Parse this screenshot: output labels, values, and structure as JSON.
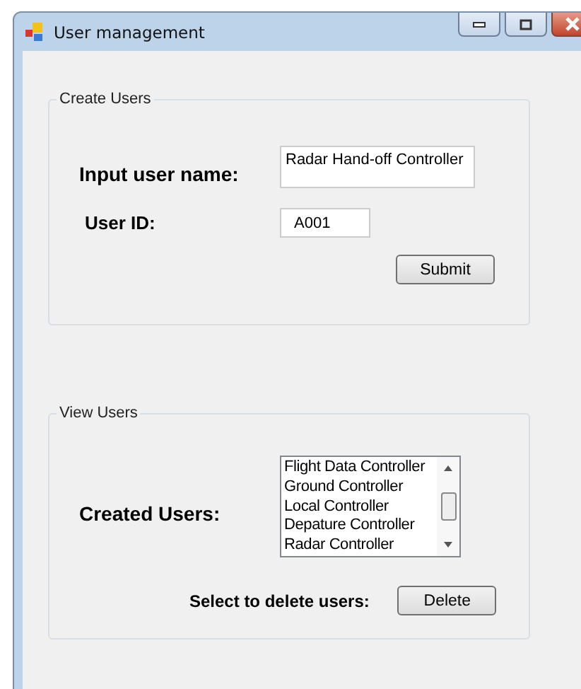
{
  "window": {
    "title": "User management"
  },
  "create_users": {
    "title": "Create Users",
    "name_label": "Input user name:",
    "name_value": "Radar Hand-off Controller",
    "id_label": "User ID:",
    "id_value": "A001",
    "submit": "Submit"
  },
  "view_users": {
    "title": "View Users",
    "list_label": "Created Users:",
    "users": [
      "Flight Data Controller",
      "Ground Controller",
      "Local Controller",
      "Depature Controller",
      "Radar Controller"
    ],
    "delete_label": "Select to delete users:",
    "delete": "Delete"
  }
}
